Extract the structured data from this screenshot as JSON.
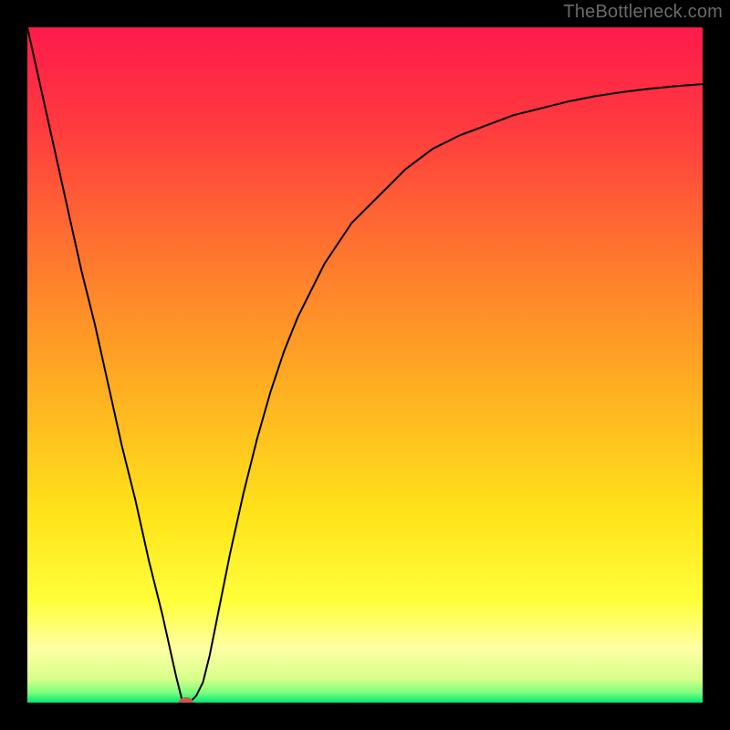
{
  "watermark": "TheBottleneck.com",
  "chart_data": {
    "type": "line",
    "title": "",
    "xlabel": "",
    "ylabel": "",
    "xlim": [
      0,
      100
    ],
    "ylim": [
      0,
      100
    ],
    "grid": false,
    "legend": false,
    "gradient_stops": [
      {
        "offset": 0.0,
        "color": "#ff1a4b"
      },
      {
        "offset": 0.15,
        "color": "#ff3b3f"
      },
      {
        "offset": 0.35,
        "color": "#ff7a2d"
      },
      {
        "offset": 0.55,
        "color": "#ffb321"
      },
      {
        "offset": 0.72,
        "color": "#ffe31a"
      },
      {
        "offset": 0.85,
        "color": "#ffff3a"
      },
      {
        "offset": 0.92,
        "color": "#ffffa5"
      },
      {
        "offset": 0.965,
        "color": "#d7ff8a"
      },
      {
        "offset": 0.985,
        "color": "#7dff7d"
      },
      {
        "offset": 1.0,
        "color": "#00e676"
      }
    ],
    "series": [
      {
        "name": "bottleneck-curve",
        "x": [
          0,
          2,
          4,
          6,
          8,
          10,
          12,
          14,
          16,
          18,
          20,
          22,
          23,
          24,
          25,
          26,
          27,
          28,
          30,
          32,
          34,
          36,
          38,
          40,
          44,
          48,
          52,
          56,
          60,
          64,
          68,
          72,
          76,
          80,
          84,
          88,
          92,
          96,
          100
        ],
        "y": [
          100,
          91,
          82,
          73,
          64,
          56,
          47,
          38,
          30,
          21,
          13,
          4,
          0,
          0,
          1,
          3,
          7,
          12,
          22,
          31,
          39,
          46,
          52,
          57,
          65,
          71,
          75,
          79,
          82,
          84,
          85.5,
          87,
          88,
          89,
          89.8,
          90.4,
          90.9,
          91.3,
          91.6
        ]
      }
    ],
    "marker": {
      "x": 23.5,
      "y": 0,
      "rx": 1.1,
      "ry": 0.8,
      "color": "#c95a4b"
    }
  }
}
